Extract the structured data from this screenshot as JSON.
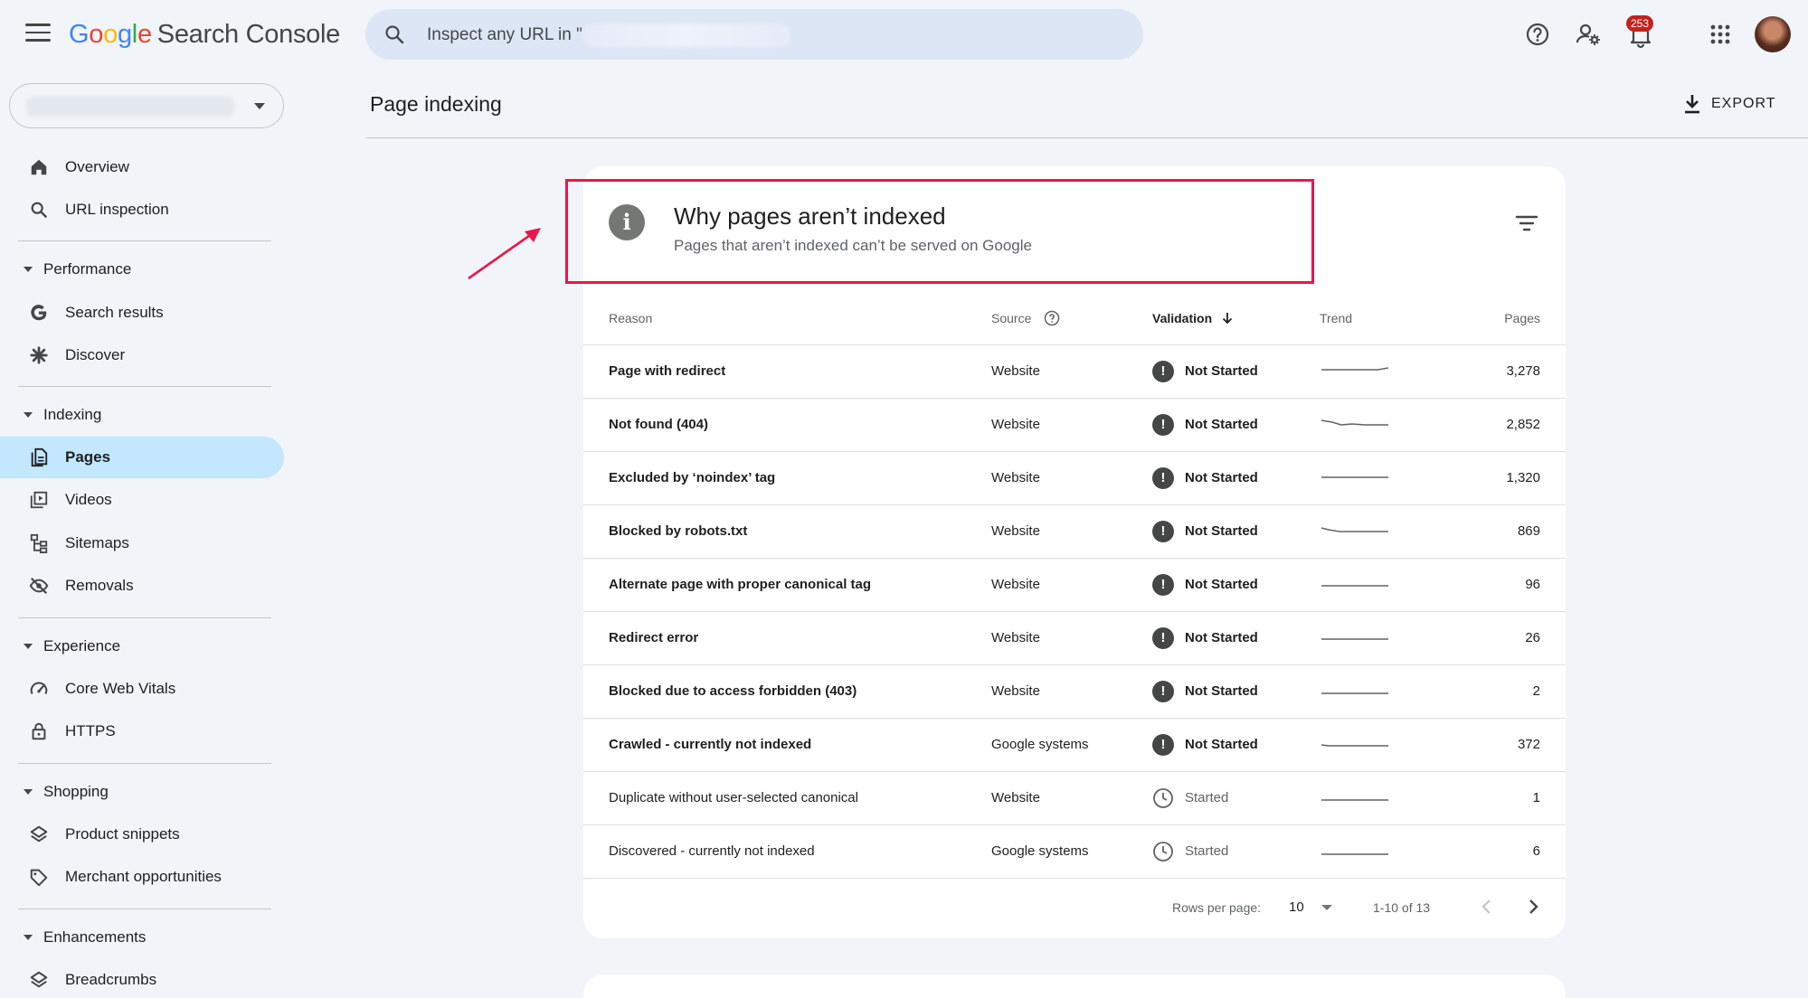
{
  "app": {
    "logo_letters": [
      "G",
      "o",
      "o",
      "g",
      "l",
      "e"
    ],
    "product_name": "Search Console"
  },
  "search": {
    "placeholder": "Inspect any URL in \""
  },
  "header_icons": [
    "help-icon",
    "admin-settings-icon",
    "notifications-icon",
    "apps-icon",
    "avatar"
  ],
  "notifications_count": "253",
  "sidebar": {
    "items": [
      {
        "label": "Overview",
        "icon": "home-icon"
      },
      {
        "label": "URL inspection",
        "icon": "search-icon"
      }
    ],
    "sections": [
      {
        "label": "Performance",
        "items": [
          {
            "label": "Search results",
            "icon": "google-g-icon"
          },
          {
            "label": "Discover",
            "icon": "asterisk-icon"
          }
        ]
      },
      {
        "label": "Indexing",
        "items": [
          {
            "label": "Pages",
            "icon": "pages-icon",
            "active": true
          },
          {
            "label": "Videos",
            "icon": "video-pages-icon"
          },
          {
            "label": "Sitemaps",
            "icon": "sitemap-icon"
          },
          {
            "label": "Removals",
            "icon": "eye-off-icon"
          }
        ]
      },
      {
        "label": "Experience",
        "items": [
          {
            "label": "Core Web Vitals",
            "icon": "speed-icon"
          },
          {
            "label": "HTTPS",
            "icon": "lock-icon"
          }
        ]
      },
      {
        "label": "Shopping",
        "items": [
          {
            "label": "Product snippets",
            "icon": "layers-icon"
          },
          {
            "label": "Merchant opportunities",
            "icon": "tag-icon"
          }
        ]
      },
      {
        "label": "Enhancements",
        "items": [
          {
            "label": "Breadcrumbs",
            "icon": "layers-icon"
          }
        ]
      }
    ]
  },
  "main": {
    "page_title": "Page indexing",
    "export_label": "EXPORT"
  },
  "card": {
    "title": "Why pages aren’t indexed",
    "subtitle": "Pages that aren’t indexed can’t be served on Google",
    "columns": {
      "reason": "Reason",
      "source": "Source",
      "validation": "Validation",
      "trend": "Trend",
      "pages": "Pages"
    },
    "rows": [
      {
        "reason": "Page with redirect",
        "source": "Website",
        "validation": "Not Started",
        "pages": "3,278",
        "bold": true
      },
      {
        "reason": "Not found (404)",
        "source": "Website",
        "validation": "Not Started",
        "pages": "2,852",
        "bold": true
      },
      {
        "reason": "Excluded by ‘noindex’ tag",
        "source": "Website",
        "validation": "Not Started",
        "pages": "1,320",
        "bold": true
      },
      {
        "reason": "Blocked by robots.txt",
        "source": "Website",
        "validation": "Not Started",
        "pages": "869",
        "bold": true
      },
      {
        "reason": "Alternate page with proper canonical tag",
        "source": "Website",
        "validation": "Not Started",
        "pages": "96",
        "bold": true
      },
      {
        "reason": "Redirect error",
        "source": "Website",
        "validation": "Not Started",
        "pages": "26",
        "bold": true
      },
      {
        "reason": "Blocked due to access forbidden (403)",
        "source": "Website",
        "validation": "Not Started",
        "pages": "2",
        "bold": true
      },
      {
        "reason": "Crawled - currently not indexed",
        "source": "Google systems",
        "validation": "Not Started",
        "pages": "372",
        "bold": true
      },
      {
        "reason": "Duplicate without user-selected canonical",
        "source": "Website",
        "validation": "Started",
        "pages": "1",
        "bold": false
      },
      {
        "reason": "Discovered - currently not indexed",
        "source": "Google systems",
        "validation": "Started",
        "pages": "6",
        "bold": false
      }
    ],
    "pagination": {
      "rows_per_page_label": "Rows per page:",
      "rows_per_page_value": "10",
      "range": "1-10 of 13"
    }
  },
  "colors": {
    "highlight_border": "#e8174b",
    "active_nav": "#c2e7ff",
    "search_bg": "#dde6f5",
    "badge": "#c5221f"
  }
}
